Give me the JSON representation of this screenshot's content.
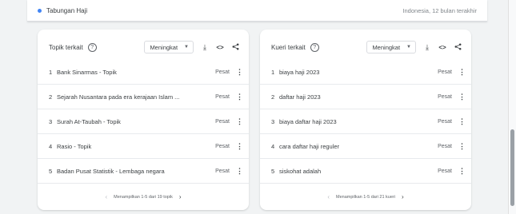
{
  "header": {
    "term": "Tabungan Haji",
    "meta": "Indonesia, 12 bulan terakhir",
    "dot_color": "#4285f4"
  },
  "left_card": {
    "title": "Topik terkait",
    "sort_value": "Meningkat",
    "rows": [
      {
        "index": "1",
        "label": "Bank Sinarmas - Topik",
        "value": "Pesat"
      },
      {
        "index": "2",
        "label": "Sejarah Nusantara pada era kerajaan Islam ...",
        "value": "Pesat"
      },
      {
        "index": "3",
        "label": "Surah At-Taubah - Topik",
        "value": "Pesat"
      },
      {
        "index": "4",
        "label": "Rasio - Topik",
        "value": "Pesat"
      },
      {
        "index": "5",
        "label": "Badan Pusat Statistik - Lembaga negara",
        "value": "Pesat"
      }
    ],
    "pagination": "Menampilkan 1-5 dari 19 topik"
  },
  "right_card": {
    "title": "Kueri terkait",
    "sort_value": "Meningkat",
    "rows": [
      {
        "index": "1",
        "label": "biaya haji 2023",
        "value": "Pesat"
      },
      {
        "index": "2",
        "label": "daftar haji 2023",
        "value": "Pesat"
      },
      {
        "index": "3",
        "label": "biaya daftar haji 2023",
        "value": "Pesat"
      },
      {
        "index": "4",
        "label": "cara daftar haji reguler",
        "value": "Pesat"
      },
      {
        "index": "5",
        "label": "siskohat adalah",
        "value": "Pesat"
      }
    ],
    "pagination": "Menampilkan 1-5 dari 21 kueri"
  },
  "icons": {
    "help": "help-circle-icon",
    "download": "download-icon",
    "embed": "code-embed-icon",
    "share": "share-icon",
    "more": "more-vert-icon",
    "prev": "chevron-left-icon",
    "next": "chevron-right-icon"
  }
}
